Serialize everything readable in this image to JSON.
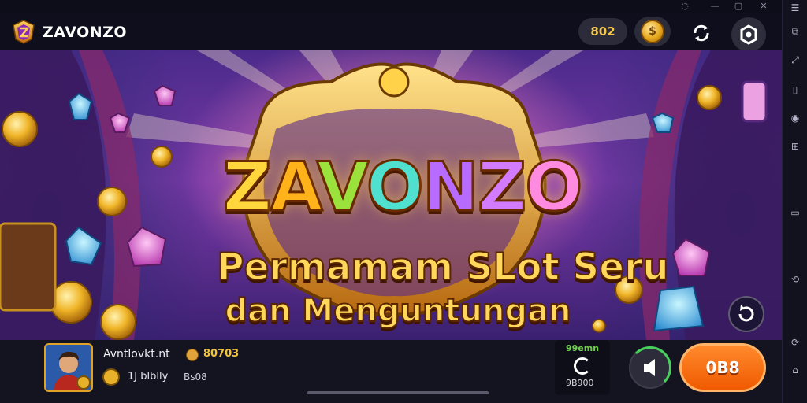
{
  "app": {
    "name": "ZAVONZO"
  },
  "topbar": {
    "coin_balance": "802",
    "reward_symbol": "$"
  },
  "hero": {
    "title_letters": [
      "Z",
      "A",
      "V",
      "O",
      "N",
      "Z",
      "O"
    ],
    "subtitle_line1": "Permamam SLot Seru",
    "subtitle_line2": "dan Menguntungan"
  },
  "player": {
    "username": "Avntlovkt.nt",
    "coins": "80703",
    "level_label": "1J blblly",
    "level_value": "Bs08"
  },
  "status": {
    "top": "99emn",
    "bottom": "9B900"
  },
  "actions": {
    "play_label": "0B8"
  },
  "colors": {
    "accent_orange": "#f06a00",
    "coin_gold": "#f3c43b",
    "status_green": "#6fd14a",
    "hero_purple": "#7a3aa8"
  }
}
